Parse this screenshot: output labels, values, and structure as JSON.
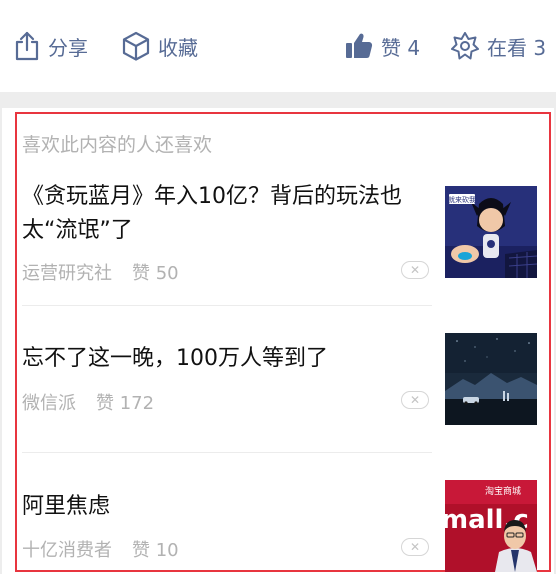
{
  "actions": {
    "share": {
      "label": "分享",
      "icon": "share-icon"
    },
    "favorite": {
      "label": "收藏",
      "icon": "cube-icon"
    },
    "like": {
      "label": "赞 4",
      "icon": "thumbs-up-icon"
    },
    "watching": {
      "label": "在看 3",
      "icon": "flower-icon"
    }
  },
  "recommend": {
    "title": "喜欢此内容的人还喜欢",
    "items": [
      {
        "title": "《贪玩蓝月》年入10亿？背后的玩法也太“流氓”了",
        "source": "运营研究社",
        "likes": "赞 50",
        "thumb_text": "就来砍我"
      },
      {
        "title": "忘不了这一晚，100万人等到了",
        "source": "微信派",
        "likes": "赞 172"
      },
      {
        "title": "阿里焦虑",
        "source": "十亿消费者",
        "likes": "赞 10",
        "thumb_text": "mall.c",
        "thumb_text_2": "淘宝商城"
      }
    ]
  },
  "colors": {
    "link": "#576b95",
    "muted": "#b2b2b2",
    "highlight_border": "#e8353f"
  }
}
